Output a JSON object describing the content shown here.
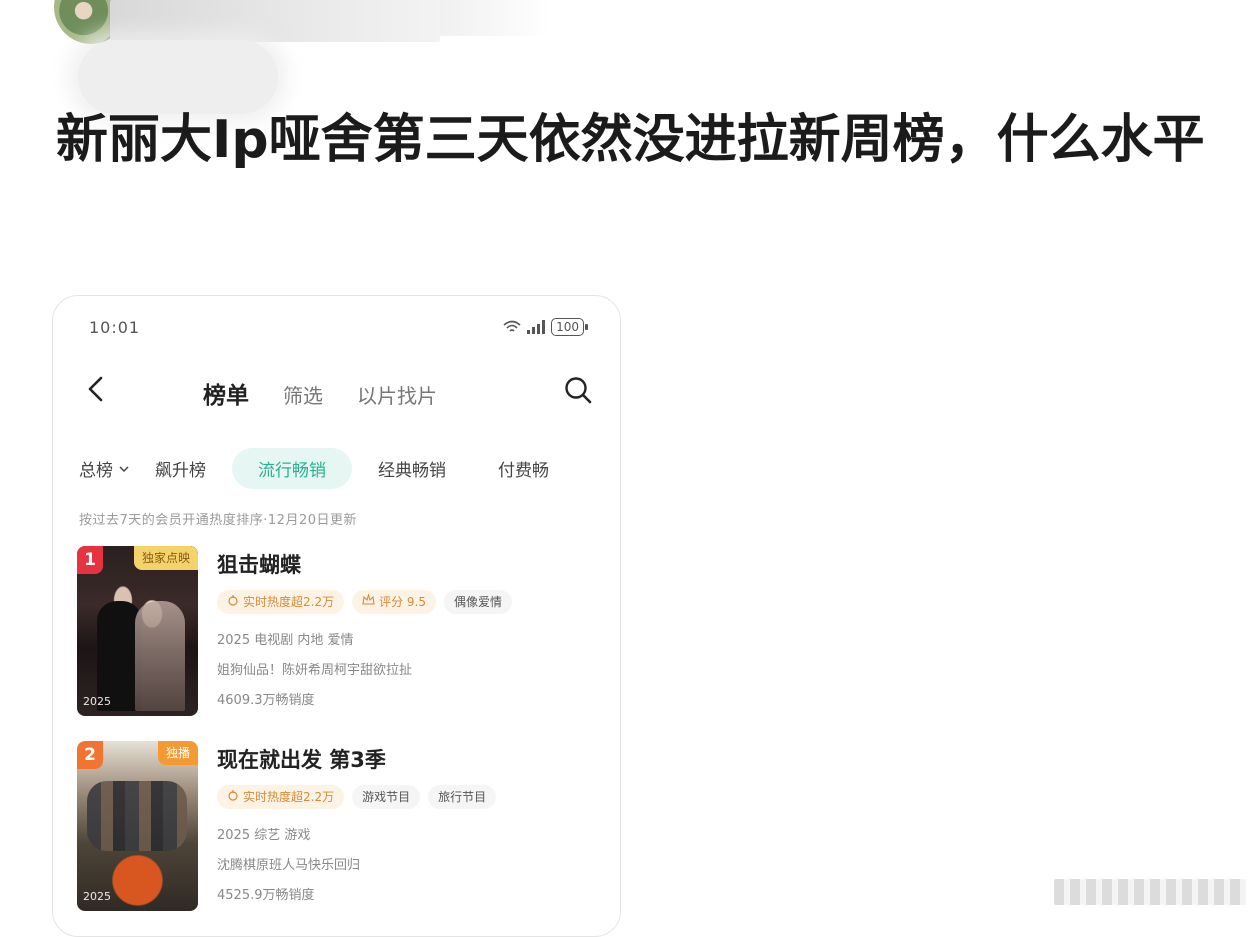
{
  "post": {
    "title": "新丽大Ip哑舍第三天依然没进拉新周榜，什么水平"
  },
  "status_bar": {
    "time": "10:01",
    "battery": "100"
  },
  "nav": {
    "tabs": [
      "榜单",
      "筛选",
      "以片找片"
    ]
  },
  "filters": {
    "first": "总榜",
    "items": [
      "飙升榜",
      "流行畅销",
      "经典畅销",
      "付费畅"
    ]
  },
  "list_subtitle": "按过去7天的会员开通热度排序·12月20日更新",
  "items": [
    {
      "rank": "1",
      "poster_tag": "独家点映",
      "poster_year": "2025",
      "title": "狙击蝴蝶",
      "tags": [
        "实时热度超2.2万",
        "评分 9.5",
        "偶像爱情"
      ],
      "meta": [
        "2025 电视剧 内地 爱情",
        "姐狗仙品！陈妍希周柯宇甜欲拉扯",
        "4609.3万畅销度"
      ]
    },
    {
      "rank": "2",
      "poster_tag": "独播",
      "poster_year": "2025",
      "title": "现在就出发 第3季",
      "tags": [
        "实时热度超2.2万",
        "游戏节目",
        "旅行节目"
      ],
      "meta": [
        "2025 综艺 游戏",
        "沈腾棋原班人马快乐回归",
        "4525.9万畅销度"
      ]
    }
  ],
  "colors": {
    "accent": "#29b18f",
    "rank1": "#e5343f",
    "rank2": "#f27433",
    "hot_tag": "#d48a3a"
  },
  "icons": [
    "back-arrow-icon",
    "search-icon",
    "wifi-icon",
    "signal-icon",
    "battery-icon",
    "chevron-down-icon",
    "flame-icon",
    "crown-icon"
  ]
}
